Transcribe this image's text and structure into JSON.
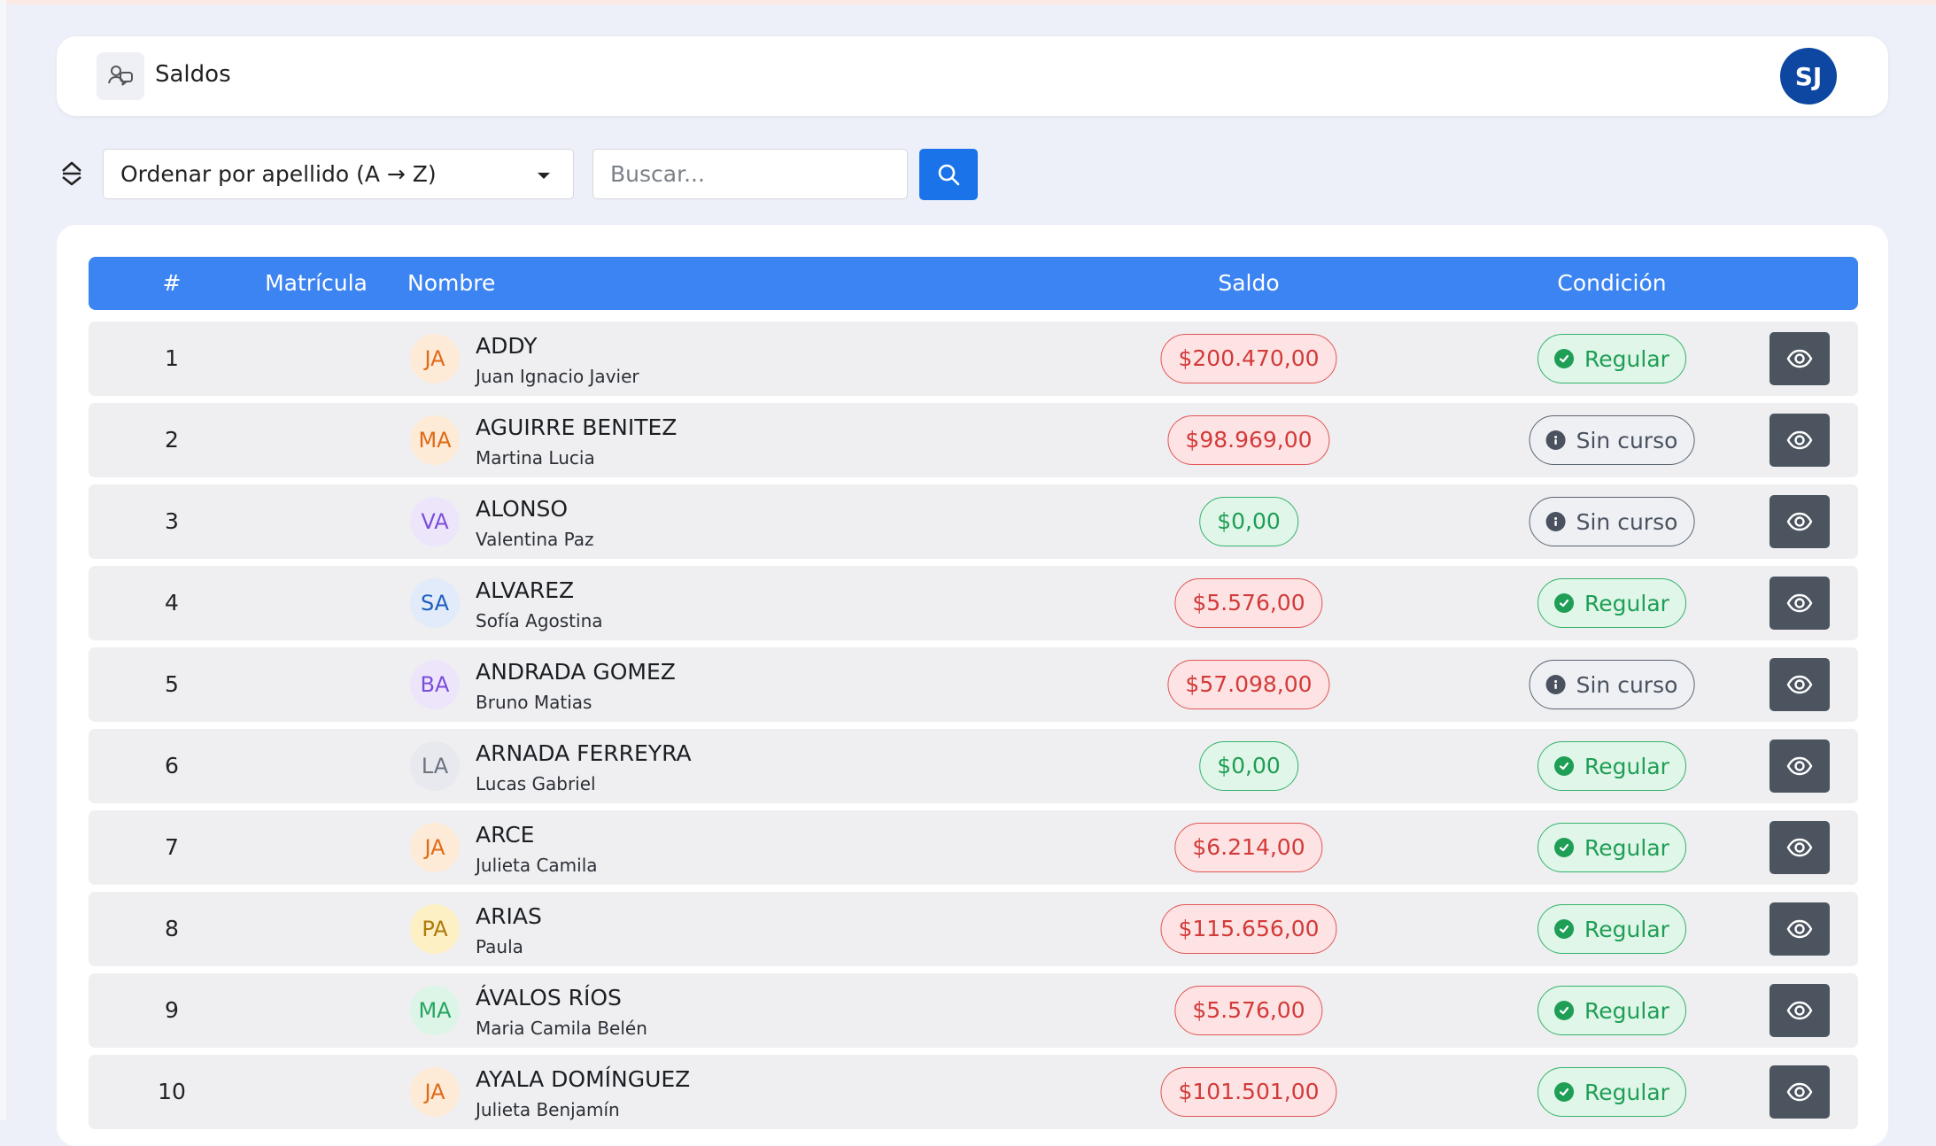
{
  "header": {
    "title": "Saldos",
    "avatar_initials": "SJ"
  },
  "toolbar": {
    "sort_label": "Ordenar por apellido (A → Z)",
    "search_placeholder": "Buscar..."
  },
  "table": {
    "columns": [
      "#",
      "Matrícula",
      "Nombre",
      "Saldo",
      "Condición"
    ],
    "rows": [
      {
        "num": "1",
        "initials": "JA",
        "avatar_color": "orange",
        "surname": "ADDY",
        "given": "Juan Ignacio Javier",
        "saldo": "$200.470,00",
        "saldo_status": "debt",
        "condicion": "Regular",
        "condicion_icon": "check-circle-icon"
      },
      {
        "num": "2",
        "initials": "MA",
        "avatar_color": "orange",
        "surname": "AGUIRRE BENITEZ",
        "given": "Martina Lucia",
        "saldo": "$98.969,00",
        "saldo_status": "debt",
        "condicion": "Sin curso",
        "condicion_icon": "info-circle-icon"
      },
      {
        "num": "3",
        "initials": "VA",
        "avatar_color": "purple",
        "surname": "ALONSO",
        "given": "Valentina Paz",
        "saldo": "$0,00",
        "saldo_status": "ok",
        "condicion": "Sin curso",
        "condicion_icon": "info-circle-icon"
      },
      {
        "num": "4",
        "initials": "SA",
        "avatar_color": "blue",
        "surname": "ALVAREZ",
        "given": "Sofía Agostina",
        "saldo": "$5.576,00",
        "saldo_status": "debt",
        "condicion": "Regular",
        "condicion_icon": "check-circle-icon"
      },
      {
        "num": "5",
        "initials": "BA",
        "avatar_color": "purple",
        "surname": "ANDRADA GOMEZ",
        "given": "Bruno Matias",
        "saldo": "$57.098,00",
        "saldo_status": "debt",
        "condicion": "Sin curso",
        "condicion_icon": "info-circle-icon"
      },
      {
        "num": "6",
        "initials": "LA",
        "avatar_color": "gray",
        "surname": "ARNADA FERREYRA",
        "given": "Lucas Gabriel",
        "saldo": "$0,00",
        "saldo_status": "ok",
        "condicion": "Regular",
        "condicion_icon": "check-circle-icon"
      },
      {
        "num": "7",
        "initials": "JA",
        "avatar_color": "orange",
        "surname": "ARCE",
        "given": "Julieta Camila",
        "saldo": "$6.214,00",
        "saldo_status": "debt",
        "condicion": "Regular",
        "condicion_icon": "check-circle-icon"
      },
      {
        "num": "8",
        "initials": "PA",
        "avatar_color": "yellow",
        "surname": "ARIAS",
        "given": "Paula",
        "saldo": "$115.656,00",
        "saldo_status": "debt",
        "condicion": "Regular",
        "condicion_icon": "check-circle-icon"
      },
      {
        "num": "9",
        "initials": "MA",
        "avatar_color": "green",
        "surname": "ÁVALOS RÍOS",
        "given": "Maria Camila Belén",
        "saldo": "$5.576,00",
        "saldo_status": "debt",
        "condicion": "Regular",
        "condicion_icon": "check-circle-icon"
      },
      {
        "num": "10",
        "initials": "JA",
        "avatar_color": "orange",
        "surname": "AYALA DOMÍNGUEZ",
        "given": "Julieta Benjamín",
        "saldo": "$101.501,00",
        "saldo_status": "debt",
        "condicion": "Regular",
        "condicion_icon": "check-circle-icon"
      }
    ]
  },
  "colors": {
    "primary": "#1a73e8",
    "table_header": "#3c84f2",
    "debt": "#d33a3a",
    "ok": "#1f9e55",
    "avatar_bg": "#0d47a1"
  }
}
